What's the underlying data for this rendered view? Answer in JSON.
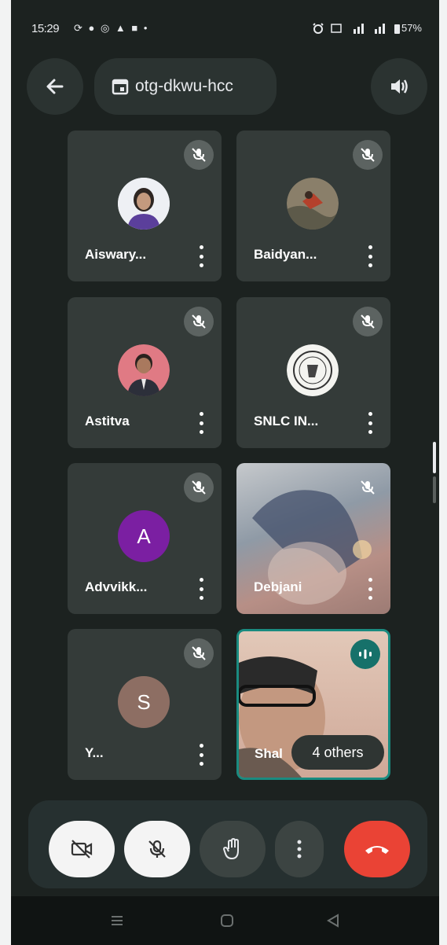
{
  "status_bar": {
    "time": "15:29",
    "left_icons": "⟳ ● ◎ ▲ ■ •",
    "right_icons": [
      "alarm-icon",
      "hd-signal-icon",
      "4g-signal-icon",
      "signal-icon"
    ],
    "battery": "57%"
  },
  "header": {
    "back_icon": "arrow-left-icon",
    "meeting_code": "otg-dkwu-hcc",
    "calendar_icon": "calendar-icon",
    "speaker_icon": "speaker-icon"
  },
  "participants": [
    {
      "name": "Aiswary...",
      "muted": true,
      "avatar": "photo"
    },
    {
      "name": "Baidyan...",
      "muted": true,
      "avatar": "photo"
    },
    {
      "name": "Astitva",
      "muted": true,
      "avatar": "photo"
    },
    {
      "name": "SNLC IN...",
      "muted": true,
      "avatar": "logo"
    },
    {
      "name": "Advvikk...",
      "muted": true,
      "avatar": "letter",
      "initial": "A",
      "color": "#7b1fa2"
    },
    {
      "name": "Debjani",
      "muted": true,
      "avatar": "video"
    },
    {
      "name": "Y...",
      "muted": true,
      "avatar": "letter",
      "initial": "S",
      "color": "#8d6e63"
    },
    {
      "name": "Shal",
      "muted": false,
      "avatar": "video",
      "speaking": true
    }
  ],
  "others_badge": "4 others",
  "controls": {
    "camera": "camera-off-icon",
    "mic": "mic-off-icon",
    "hand": "raise-hand-icon",
    "more": "more-vert-icon",
    "end": "end-call-icon",
    "end_color": "#ea4335"
  },
  "navigation": [
    "menu-nav-icon",
    "home-nav-icon",
    "back-nav-icon"
  ]
}
